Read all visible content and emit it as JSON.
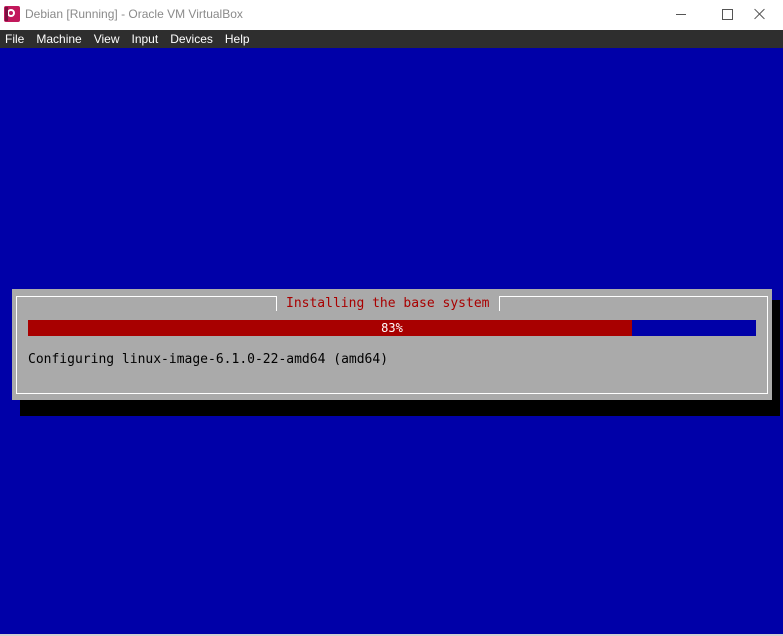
{
  "window": {
    "title": "Debian [Running] - Oracle VM VirtualBox"
  },
  "menu": {
    "items": [
      {
        "label": "File"
      },
      {
        "label": "Machine"
      },
      {
        "label": "View"
      },
      {
        "label": "Input"
      },
      {
        "label": "Devices"
      },
      {
        "label": "Help"
      }
    ]
  },
  "installer": {
    "dialog_title": "Installing the base system",
    "progress_percent": 83,
    "progress_label": "83%",
    "status": "Configuring linux-image-6.1.0-22-amd64 (amd64)"
  },
  "colors": {
    "screen_background": "#0000a8",
    "dialog_background": "#aaaaaa",
    "title_text": "#a80000",
    "progress_fill": "#a80000",
    "progress_track": "#0000a8",
    "menubar_background": "#2e2e2e"
  },
  "icons": {
    "app": "virtualbox-icon",
    "minimize": "minimize-icon",
    "maximize": "maximize-icon",
    "close": "close-icon"
  }
}
